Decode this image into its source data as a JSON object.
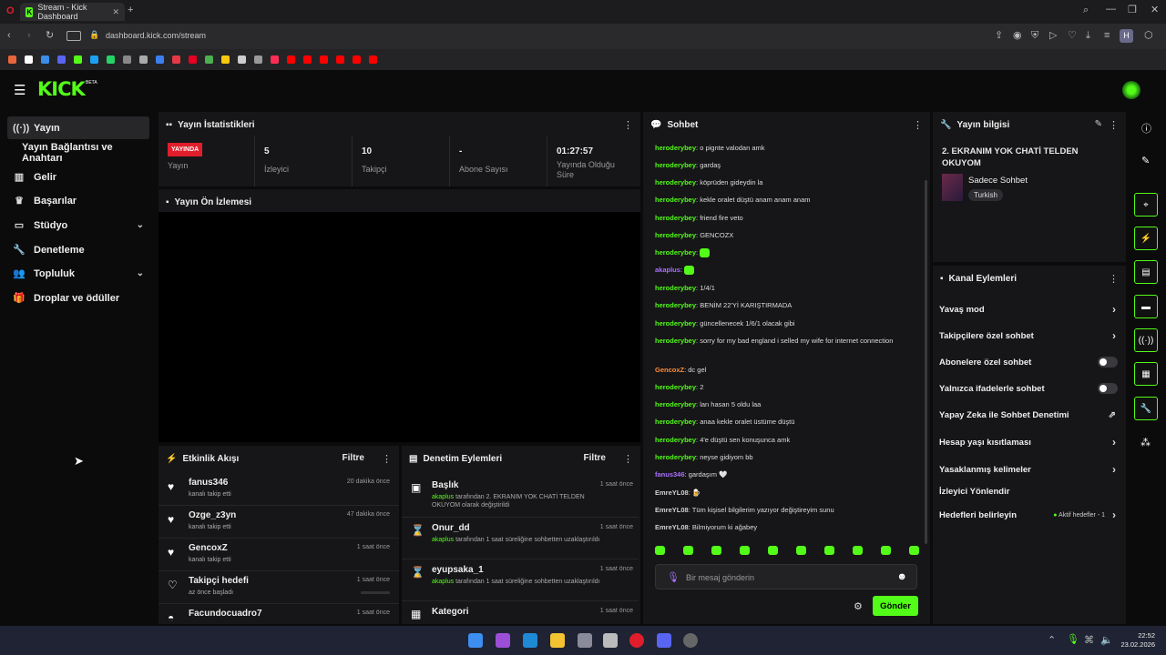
{
  "browser": {
    "tab_title": "Stream - Kick Dashboard",
    "url": "dashboard.kick.com/stream",
    "profile_initial": "H"
  },
  "header": {
    "logo": "KICK",
    "beta": "BETA"
  },
  "sidebar": {
    "items": [
      {
        "label": "Yayın",
        "icon": "broadcast-icon"
      },
      {
        "label": "Yayın Bağlantısı ve Anahtarı",
        "icon": "none"
      },
      {
        "label": "Gelir",
        "icon": "chart-icon"
      },
      {
        "label": "Başarılar",
        "icon": "trophy-icon"
      },
      {
        "label": "Stüdyo",
        "icon": "studio-icon"
      },
      {
        "label": "Denetleme",
        "icon": "wrench-icon"
      },
      {
        "label": "Topluluk",
        "icon": "people-icon"
      },
      {
        "label": "Droplar ve ödüller",
        "icon": "gift-icon"
      }
    ]
  },
  "stats": {
    "title": "Yayın İstatistikleri",
    "live_badge": "YAYINDA",
    "live_label": "Yayın",
    "viewers_value": "5",
    "viewers_label": "İzleyici",
    "followers_value": "10",
    "followers_label": "Takipçi",
    "subs_value": "-",
    "subs_label": "Abone Sayısı",
    "uptime_value": "01:27:57",
    "uptime_label": "Yayında Olduğu Süre"
  },
  "preview": {
    "title": "Yayın Ön İzlemesi"
  },
  "activity": {
    "title": "Etkinlik Akışı",
    "filter": "Filtre",
    "rows": [
      {
        "name": "fanus346",
        "sub": "kanalı takip etti",
        "time": "20 dakika önce"
      },
      {
        "name": "Ozge_z3yn",
        "sub": "kanalı takip etti",
        "time": "47 dakika önce"
      },
      {
        "name": "GencoxZ",
        "sub": "kanalı takip etti",
        "time": "1 saat önce"
      },
      {
        "name": "Takipçi hedefi",
        "sub": "az önce başladı",
        "time": "1 saat önce"
      },
      {
        "name": "Facundocuadro7",
        "sub": "",
        "time": "1 saat önce"
      }
    ]
  },
  "moderation": {
    "title": "Denetim Eylemleri",
    "filter": "Filtre",
    "rows": [
      {
        "name": "Başlık",
        "actor": "akaplus",
        "desc": "tarafından 2. EKRANIM YOK CHATİ TELDEN OKUYOM olarak değiştirildi",
        "time": "1 saat önce"
      },
      {
        "name": "Onur_dd",
        "actor": "akaplus",
        "desc": "tarafından 1 saat süreliğine sohbetten uzaklaştırıldı",
        "time": "1 saat önce"
      },
      {
        "name": "eyupsaka_1",
        "actor": "akaplus",
        "desc": "tarafından 1 saat süreliğine sohbetten uzaklaştırıldı",
        "time": "1 saat önce"
      },
      {
        "name": "Kategori",
        "actor": "",
        "desc": "",
        "time": "1 saat önce"
      }
    ]
  },
  "chat": {
    "title": "Sohbet",
    "messages": [
      {
        "user": "heroderybey",
        "text": "o pignte valodan amk",
        "color": "u1"
      },
      {
        "user": "heroderybey",
        "text": "gardaş",
        "color": "u1"
      },
      {
        "user": "heroderybey",
        "text": "köprüden gideydin la",
        "color": "u1"
      },
      {
        "user": "heroderybey",
        "text": "kekle oralet düştü anam anam anam",
        "color": "u1"
      },
      {
        "user": "heroderybey",
        "text": "friend fire veto",
        "color": "u1"
      },
      {
        "user": "heroderybey",
        "text": "GENCOZX",
        "color": "u1"
      },
      {
        "user": "heroderybey",
        "text": "",
        "color": "u1",
        "emote": true
      },
      {
        "user": "akaplus",
        "text": "",
        "color": "u3",
        "emote": true
      },
      {
        "user": "heroderybey",
        "text": "1/4/1",
        "color": "u1"
      },
      {
        "user": "heroderybey",
        "text": "BENİM 22'Yİ KARIŞTIRMADA",
        "color": "u1"
      },
      {
        "user": "heroderybey",
        "text": "güncellenecek 1/6/1 olacak gibi",
        "color": "u1"
      },
      {
        "user": "heroderybey",
        "text": "sorry for my bad england i selled my wife for internet connection",
        "color": "u1"
      },
      {
        "user": "GencoxZ",
        "text": "dc gel",
        "color": "u2"
      },
      {
        "user": "heroderybey",
        "text": "2",
        "color": "u1"
      },
      {
        "user": "heroderybey",
        "text": "lan hasan 5 oldu laa",
        "color": "u1"
      },
      {
        "user": "heroderybey",
        "text": "anaa kekle oralet üstüme düştü",
        "color": "u1"
      },
      {
        "user": "heroderybey",
        "text": "4'e düştü sen konuşunca amk",
        "color": "u1"
      },
      {
        "user": "heroderybey",
        "text": "neyse gidiyom bb",
        "color": "u1"
      },
      {
        "user": "fanus346",
        "text": "gardaşım 🤍",
        "color": "u3"
      },
      {
        "user": "EmreYL08",
        "text": "🍺",
        "color": "u4"
      },
      {
        "user": "EmreYL08",
        "text": "Tüm kişisel bilgilerim yazıyor değiştireyim sunu",
        "color": "u4"
      },
      {
        "user": "EmreYL08",
        "text": "Bilmiyorum ki ağabey",
        "color": "u4"
      }
    ],
    "input_placeholder": "Bir mesaj gönderin",
    "send_label": "Gönder"
  },
  "stream_info": {
    "title": "Yayın bilgisi",
    "stream_title": "2. EKRANIM YOK CHATİ TELDEN OKUYOM",
    "category": "Sadece Sohbet",
    "tag": "Turkish"
  },
  "channel_actions": {
    "title": "Kanal Eylemleri",
    "items": [
      {
        "label": "Yavaş mod",
        "control": "chevron"
      },
      {
        "label": "Takipçilere özel sohbet",
        "control": "chevron"
      },
      {
        "label": "Abonelere özel sohbet",
        "control": "toggle"
      },
      {
        "label": "Yalnızca ifadelerle sohbet",
        "control": "toggle"
      },
      {
        "label": "Yapay Zeka ile Sohbet Denetimi",
        "control": "external"
      },
      {
        "label": "Hesap yaşı kısıtlaması",
        "control": "chevron"
      },
      {
        "label": "Yasaklanmış kelimeler",
        "control": "chevron"
      },
      {
        "label": "İzleyici Yönlendir",
        "control": "none"
      },
      {
        "label": "Hedefleri belirleyin",
        "control": "chevron"
      }
    ],
    "goals_status": "Aktif hedefler - 1"
  },
  "taskbar": {
    "time": "22:52",
    "date": "23.02.2026"
  },
  "colors": {
    "accent": "#53fc18",
    "live": "#e01e2b"
  }
}
